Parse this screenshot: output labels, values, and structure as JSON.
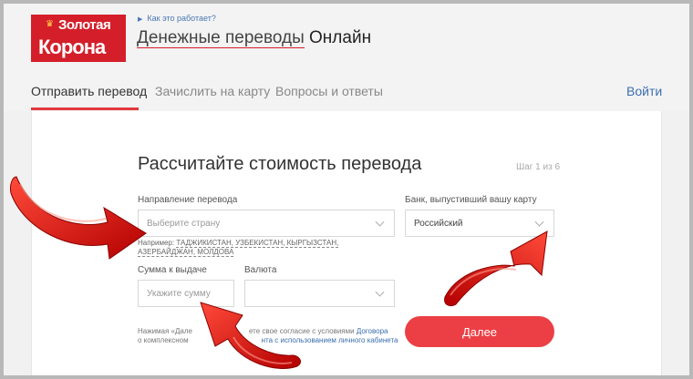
{
  "header": {
    "logo_line1": "Золотая",
    "logo_line2": "Корона",
    "how_it_works": "Как это работает?",
    "title_part1": "Денежные переводы",
    "title_part2": "Онлайн"
  },
  "nav": {
    "items": [
      {
        "label": "Отправить перевод",
        "active": true
      },
      {
        "label": "Зачислить на карту",
        "active": false
      },
      {
        "label": "Вопросы и ответы",
        "active": false
      }
    ],
    "login": "Войти"
  },
  "form": {
    "title": "Рассчитайте стоимость перевода",
    "step": "Шаг 1 из 6",
    "direction_label": "Направление перевода",
    "direction_placeholder": "Выберите страну",
    "example_prefix": "Например:",
    "example_values": "ТАДЖИКИСТАН, УЗБЕКИСТАН, КЫРГЫЗСТАН, АЗЕРБАЙДЖАН, МОЛДОВА",
    "bank_label": "Банк, выпустивший вашу карту",
    "bank_value": "Российский",
    "amount_label": "Сумма к выдаче",
    "amount_placeholder": "Укажите сумму",
    "currency_label": "Валюта",
    "currency_value": "",
    "footnote_part1": "Нажимая «Дале",
    "footnote_part2": "ете свое согласие с условиями",
    "footnote_link1": "Договора",
    "footnote_part3": "о комплексном",
    "footnote_link2": "нта с использованием личного кабинета",
    "submit_label": "Далее"
  },
  "colors": {
    "brand_red": "#d41f2a",
    "button_red": "#ec3f45",
    "link_blue": "#3b6fb0",
    "arrow_red": "#e01b1b"
  },
  "icons": [
    "crown-icon",
    "chevron-down-icon",
    "play-triangle-icon",
    "curved-arrow-icon"
  ]
}
